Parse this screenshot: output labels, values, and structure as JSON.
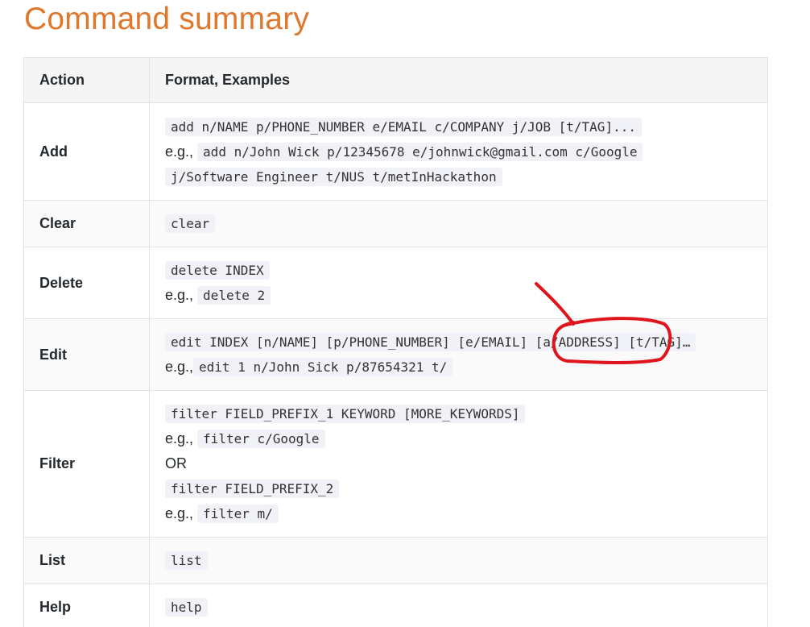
{
  "page": {
    "title": "Command summary"
  },
  "table": {
    "headers": [
      "Action",
      "Format, Examples"
    ],
    "rows": {
      "add": {
        "action": "Add",
        "format": "add n/NAME p/PHONE_NUMBER e/EMAIL c/COMPANY j/JOB [t/TAG]...",
        "eg_prefix": "e.g.,",
        "example_line1": "add n/John Wick p/12345678 e/johnwick@gmail.com c/Google",
        "example_line2": "j/Software Engineer t/NUS t/metInHackathon"
      },
      "clear": {
        "action": "Clear",
        "format": "clear"
      },
      "delete": {
        "action": "Delete",
        "format": "delete INDEX",
        "eg_prefix": "e.g.,",
        "example": "delete 2"
      },
      "edit": {
        "action": "Edit",
        "format": "edit INDEX [n/NAME] [p/PHONE_NUMBER] [e/EMAIL] [a/ADDRESS] [t/TAG]…",
        "eg_prefix": "e.g.,",
        "example": "edit 1 n/John Sick p/87654321 t/"
      },
      "filter": {
        "action": "Filter",
        "format1": "filter FIELD_PREFIX_1 KEYWORD [MORE_KEYWORDS]",
        "eg_prefix": "e.g.,",
        "example1": "filter c/Google",
        "or_text": "OR",
        "format2": "filter FIELD_PREFIX_2",
        "example2": "filter m/"
      },
      "list": {
        "action": "List",
        "format": "list"
      },
      "help": {
        "action": "Help",
        "format": "help"
      }
    }
  },
  "colors": {
    "title": "#e0782c",
    "annotation": "#e0141c",
    "code_bg": "#f1f1f8"
  }
}
